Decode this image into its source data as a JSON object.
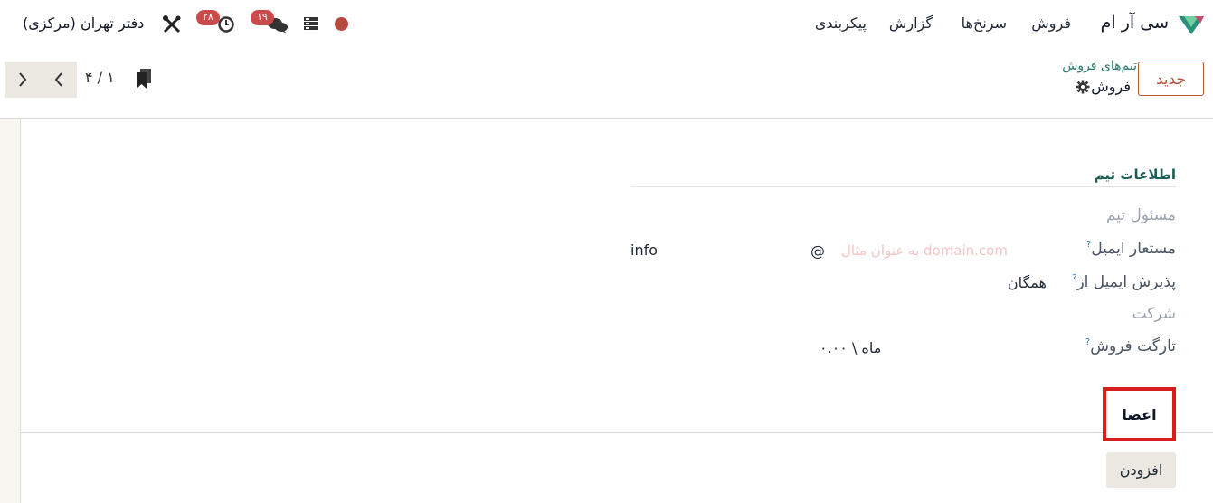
{
  "topbar": {
    "app_name": "سی آر ام",
    "menu": [
      "فروش",
      "سرنخ‌ها",
      "گزارش",
      "پیکربندی"
    ],
    "messages_badge": "۱۹",
    "activities_badge": "۲۸",
    "company": "دفتر تهران (مرکزی)",
    "status_color": "#b54a40"
  },
  "control": {
    "new_button": "جدید",
    "breadcrumb_parent": "تیم‌های فروش",
    "record_title": "فروش",
    "pager_value": "۴ / ۱"
  },
  "form": {
    "section_title": "اطلاعات تیم",
    "fields": {
      "team_leader": "مسئول تیم",
      "email_alias": "مستعار ایمیل",
      "email_alias_value": "info",
      "email_at": "@",
      "email_domain_placeholder": "به عنوان مثال domain.com",
      "accept_emails_from": "پذیرش ایمیل از",
      "accept_emails_value": "همگان",
      "company": "شرکت",
      "sales_target": "تارگت فروش",
      "sales_target_value": "۰.۰۰ \\ ماه"
    },
    "help_mark": "?",
    "members_tab": "اعضا",
    "add_button": "افزودن"
  }
}
